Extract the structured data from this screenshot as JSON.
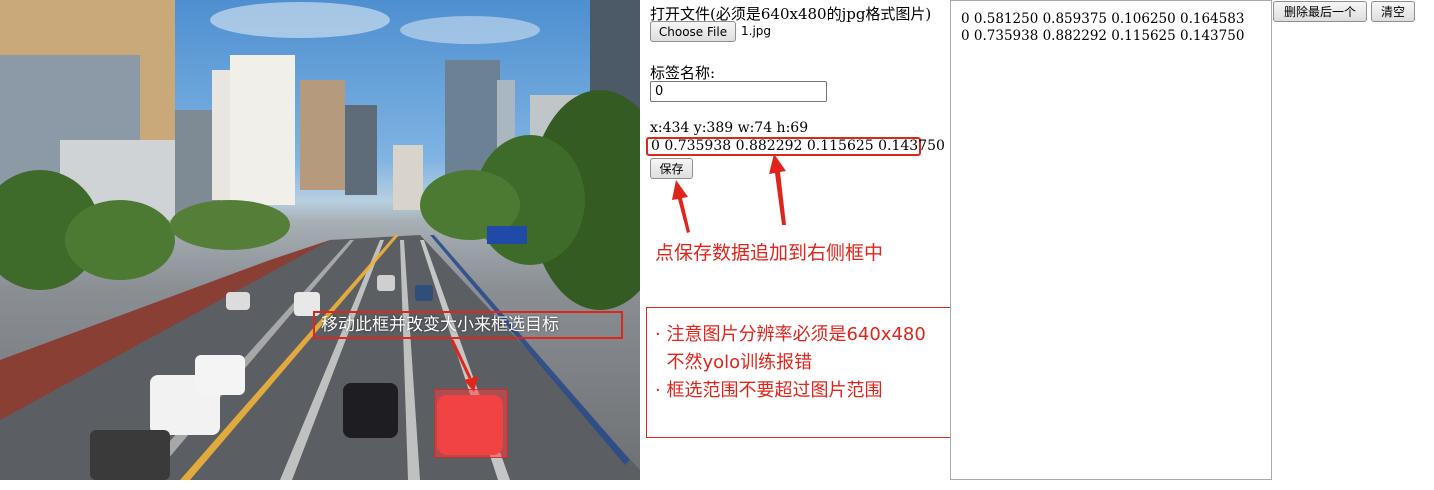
{
  "photo": {
    "hint": "移动此框并改变大小来框选目标"
  },
  "form": {
    "open_file_label": "打开文件(必须是640x480的jpg格式图片)",
    "choose_file_button": "Choose File",
    "file_name": "1.jpg",
    "tag_label": "标签名称:",
    "tag_value": "0",
    "coords_text": "x:434 y:389 w:74 h:69",
    "current_line": "0 0.735938 0.882292 0.115625 0.143750",
    "save_button": "保存",
    "save_note": "点保存数据追加到右侧框中",
    "notes": [
      "· 注意图片分辨率必须是640x480",
      "  不然yolo训练报错",
      "· 框选范围不要超过图片范围"
    ]
  },
  "output": {
    "text": "0 0.581250 0.859375 0.106250 0.164583\n0 0.735938 0.882292 0.115625 0.143750"
  },
  "toolbar": {
    "delete_last_button": "删除最后一个",
    "clear_button": "清空"
  },
  "colors": {
    "annotation_red": "#e0251c",
    "selection_fill": "#ff3c3c"
  }
}
